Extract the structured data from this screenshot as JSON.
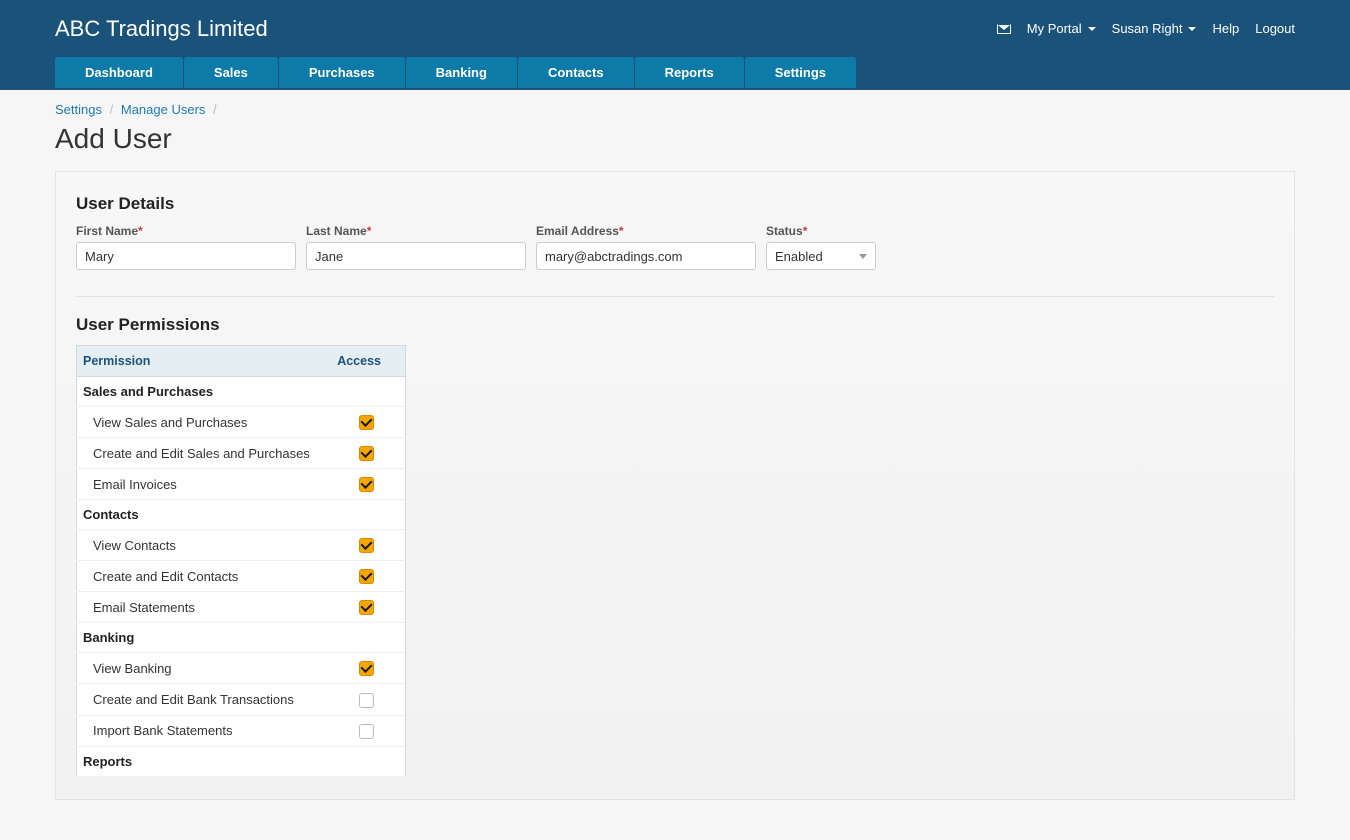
{
  "header": {
    "company": "ABC Tradings Limited",
    "my_portal": "My Portal",
    "username": "Susan Right",
    "help": "Help",
    "logout": "Logout"
  },
  "nav": {
    "items": [
      "Dashboard",
      "Sales",
      "Purchases",
      "Banking",
      "Contacts",
      "Reports",
      "Settings"
    ]
  },
  "breadcrumb": {
    "settings": "Settings",
    "manage_users": "Manage Users"
  },
  "page": {
    "title": "Add User"
  },
  "user_details": {
    "section_title": "User Details",
    "first_name": {
      "label": "First Name",
      "value": "Mary"
    },
    "last_name": {
      "label": "Last Name",
      "value": "Jane"
    },
    "email": {
      "label": "Email Address",
      "value": "mary@abctradings.com"
    },
    "status": {
      "label": "Status",
      "value": "Enabled"
    }
  },
  "permissions": {
    "section_title": "User Permissions",
    "col_permission": "Permission",
    "col_access": "Access",
    "groups": [
      {
        "title": "Sales and Purchases",
        "items": [
          {
            "label": "View Sales and Purchases",
            "checked": true
          },
          {
            "label": "Create and Edit Sales and Purchases",
            "checked": true
          },
          {
            "label": "Email Invoices",
            "checked": true
          }
        ]
      },
      {
        "title": "Contacts",
        "items": [
          {
            "label": "View Contacts",
            "checked": true
          },
          {
            "label": "Create and Edit Contacts",
            "checked": true
          },
          {
            "label": "Email Statements",
            "checked": true
          }
        ]
      },
      {
        "title": "Banking",
        "items": [
          {
            "label": "View Banking",
            "checked": true
          },
          {
            "label": "Create and Edit Bank Transactions",
            "checked": false
          },
          {
            "label": "Import Bank Statements",
            "checked": false
          }
        ]
      },
      {
        "title": "Reports",
        "items": []
      }
    ]
  }
}
